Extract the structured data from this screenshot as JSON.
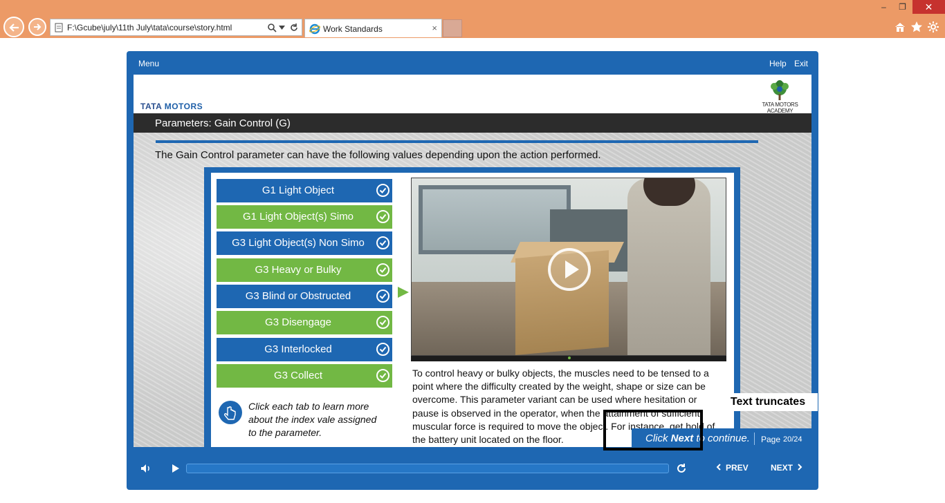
{
  "browser": {
    "address": "F:\\Gcube\\july\\11th July\\tata\\course\\story.html",
    "tab_title": "Work Standards",
    "tab_close": "×",
    "win_minimize": "–",
    "win_restore": "❐",
    "win_close": "✕"
  },
  "player": {
    "menu_label": "Menu",
    "help_label": "Help",
    "exit_label": "Exit"
  },
  "slide": {
    "brand_logo_text_1": "TATA",
    "brand_logo_text_2": " MOTORS",
    "academy_text": "TATA MOTORS ACADEMY",
    "title": "Parameters: Gain Control (G)",
    "intro": "The Gain Control parameter can have the following  values depending upon the action performed.",
    "tabs": [
      {
        "label": "G1 Light Object",
        "color": "blue"
      },
      {
        "label": "G1 Light Object(s) Simo",
        "color": "green"
      },
      {
        "label": "G3 Light Object(s) Non Simo",
        "color": "blue"
      },
      {
        "label": "G3 Heavy or Bulky",
        "color": "green"
      },
      {
        "label": "G3 Blind or Obstructed",
        "color": "blue"
      },
      {
        "label": "G3 Disengage",
        "color": "green"
      },
      {
        "label": "G3 Interlocked",
        "color": "blue"
      },
      {
        "label": "G3 Collect",
        "color": "green"
      }
    ],
    "selected_tab": "G3 Heavy or Bulky",
    "hint": "Click each tab to learn more about the index vale assigned to the parameter.",
    "description": "To control heavy or bulky objects, the muscles need to be tensed to a point where the difficulty created by the weight, shape or size can be overcome. This parameter variant can be used where hesitation or pause is observed in the operator, when the attainment of sufficient muscular force is required to move the object. For instance, get hold of the battery unit located on the floor.",
    "continue_prefix": "Click ",
    "continue_bold": "Next",
    "continue_suffix": " to continue.",
    "page_label": "Page",
    "page_number": "20/24",
    "annotation": "Text truncates"
  },
  "controls": {
    "prev_label": "PREV",
    "next_label": "NEXT",
    "progress": 0
  },
  "colors": {
    "primary_blue": "#1e67b2",
    "accent_green": "#72b844",
    "browser_chrome": "#ec9a66"
  }
}
